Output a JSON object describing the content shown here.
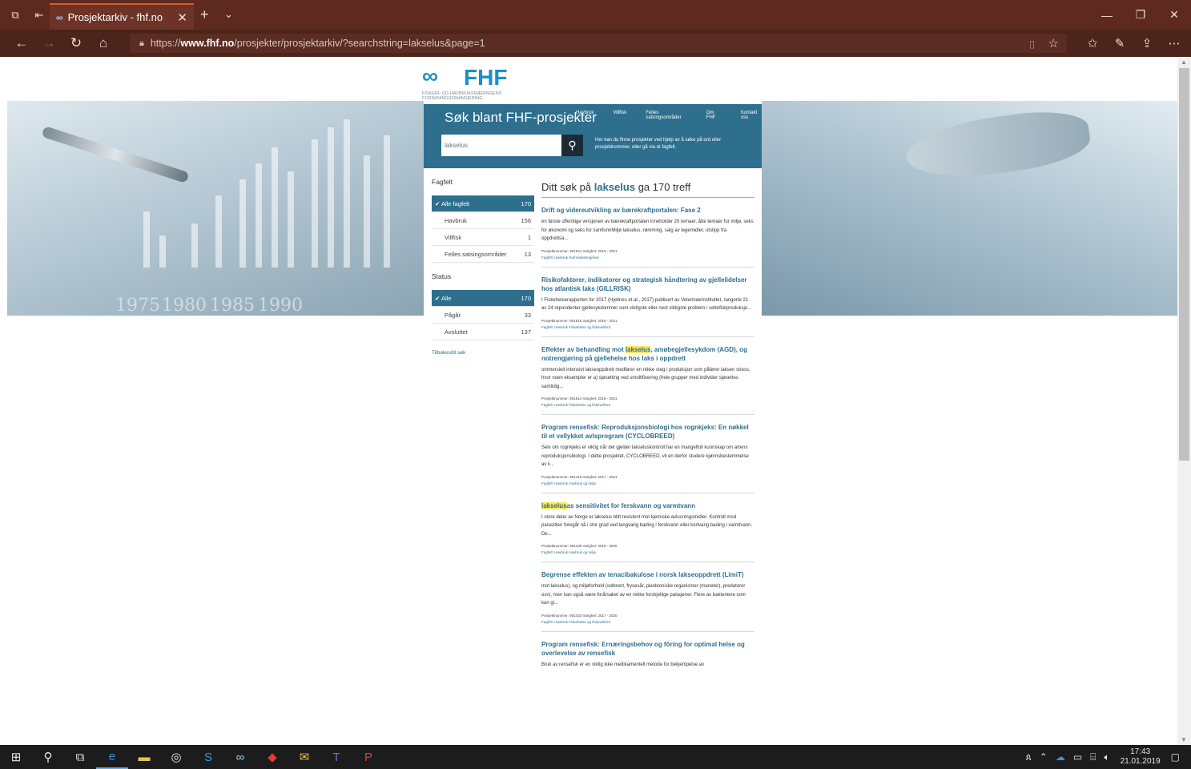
{
  "browser": {
    "tab_title": "Prosjektarkiv - fhf.no",
    "url_prefix": "https://",
    "url_host": "www.fhf.no",
    "url_path": "/prosjekter/prosjektarkiv/?searchstring=lakselus&page=1"
  },
  "site": {
    "logo_text": "FHF",
    "logo_sub": "FISKERI- OG HAVBRUKSNÆRINGENS FORSKNINGSFINANSIERING",
    "nav": [
      "Havbruk",
      "Villfisk",
      "Felles satsingsområder",
      "Om FHF",
      "Kontakt oss"
    ],
    "hero_years": [
      "1975",
      "1980",
      "1985",
      "1990"
    ]
  },
  "search": {
    "title": "Søk blant FHF-prosjekter",
    "placeholder": "lakselus",
    "help": "Her kan du finne prosjekter ved hjelp av å søke på ord eller prosjektnummer, eller gå via et fagfelt."
  },
  "filters": {
    "fagfelt_title": "Fagfelt",
    "fagfelt": [
      {
        "label": "Alle fagfelt",
        "count": "170",
        "selected": true
      },
      {
        "label": "Havbruk",
        "count": "156"
      },
      {
        "label": "Villfisk",
        "count": "1"
      },
      {
        "label": "Felles satsingsområder",
        "count": "13"
      }
    ],
    "status_title": "Status",
    "status": [
      {
        "label": "Alle",
        "count": "170",
        "selected": true
      },
      {
        "label": "Pågår",
        "count": "33"
      },
      {
        "label": "Avsluttet",
        "count": "137"
      }
    ],
    "reset": "Tilbakestill søk"
  },
  "results": {
    "head_pre": "Ditt søk på ",
    "head_term": "lakselus",
    "head_post": " ga 170 treff",
    "items": [
      {
        "title": "Drift og videreutvikling av bærekraftportalen: Fase 2",
        "desc": "en første offentlige versjonen av bærekraftportalen inneholder 20 temaer, åtte temaer for miljø, seks for økonomi og seks for samfunnMiljø lakselus, rømming, salg av legemidler, utslipp fra oppdrettsa...",
        "meta": "Prosjektnummer: 901541    Varighet: 2019 - 2021",
        "fag": "Fagfelt: Havbruk  Rammebetingelser"
      },
      {
        "title": "Risikofaktorer, indikatorer og strategisk håndtering av gjellelidelser hos atlantisk laks (GILLRISK)",
        "desc": "I Fiskehelserapporten for 2017 (Hjeltnes et al., 2017) publisert av Veterinærinstituttet, rangerte 21 av 24 repondenter gjellesykdommer som viktigste eller nest viktigste problem i settefiskproduksjo...",
        "meta": "Prosjektnummer: 901515    Varighet: 2018 - 2021",
        "fag": "Fagfelt: Havbruk  Fiskehelse og fiskevelferd"
      },
      {
        "title_pre": "Effekter av behandling mot ",
        "title_hl": "lakselus",
        "title_post": ", amøbegjellesykdom (AGD), og notrengjøring på gjellehelse hos laks i oppdrett",
        "desc": "ommersielt intensivt lakseoppdrett medfører en rekke steg i produksjon som påfører laksen stress, hvor noen eksempler er a) sjøsetting ved smoltifisering (hele grupper med individer sjøsettes samtidig...",
        "meta": "Prosjektnummer: 901514    Varighet: 2018 - 2021",
        "fag": "Fagfelt: Havbruk  Fiskehelse og fiskevelferd"
      },
      {
        "title": "Program rensefisk: Reproduksjonsbiologi hos rognkjeks: En nøkkel til et vellykket avlsprogram (CYCLOBREED)",
        "desc": "Selv om rognkjeks er viktig når det gjelder lakseluskontroll har en mangelfull kunnskap om artens reproduksjonsbiologi. I dette prosjektet, CYCLOBREED, vil en derfor studere kjønnsbestemmelse av li...",
        "meta": "Prosjektnummer: 901418    Varighet: 2017 - 2021",
        "fag": "Fagfelt: Havbruk  Havbruk og miljø"
      },
      {
        "title_hl": "lakselus",
        "title_post": "as sensitivitet for ferskvann og varmtvann",
        "desc": "I store deler av Norge er lakselus blitt resistent mot kjemiske avlusningsmidler. Kontroll mod parasitten foregår nå i stor grad ved langvarig bading i ferskvann eller kortvarig bading i varmtvann. De...",
        "meta": "Prosjektnummer: 901438    Varighet: 2018 - 2020",
        "fag": "Fagfelt: Havbruk  Havbruk og miljø"
      },
      {
        "title": "Begrense effekten av tenacibakulose i norsk lakseoppdrett (LimiT)",
        "desc": "mot lakselus), og miljøforhold (solbrent, frysesår, planktoniske organismer (maneter), predatorer osv), men kan også være forårsaket av en rekke forskjellige patogener. Flere av bakteriene som kan gi...",
        "meta": "Prosjektnummer: 901433    Varighet: 2017 - 2020",
        "fag": "Fagfelt: Havbruk  Fiskehelse og fiskevelferd"
      },
      {
        "title": "Program rensefisk: Ernæringsbehov og fôring for optimal helse og overlevelse av rensefisk",
        "desc": "Bruk av rensefisk er en viktig ikke medikamentell metode for bekjempelse av"
      }
    ]
  },
  "taskbar": {
    "time": "17:43",
    "date": "21.01.2019"
  }
}
